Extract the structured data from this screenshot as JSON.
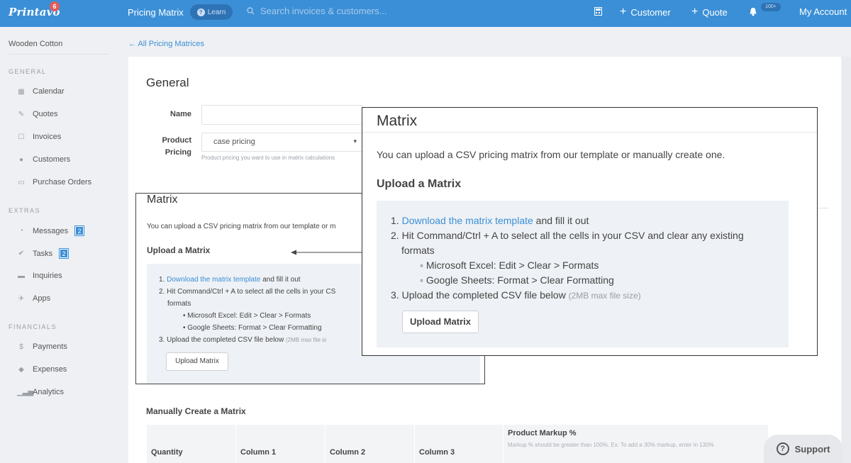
{
  "nav": {
    "brand": "Printavo",
    "brand_badge": "6",
    "title": "Pricing Matrix",
    "learn_label": "Learn",
    "search_placeholder": "Search invoices & customers...",
    "customer_label": "Customer",
    "quote_label": "Quote",
    "notifications_badge": "100+",
    "account_label": "My Account"
  },
  "sidebar": {
    "company": "Wooden Cotton",
    "sections": {
      "general": "GENERAL",
      "extras": "EXTRAS",
      "financials": "FINANCIALS"
    },
    "items": {
      "calendar": "Calendar",
      "quotes": "Quotes",
      "invoices": "Invoices",
      "customers": "Customers",
      "purchase_orders": "Purchase Orders",
      "messages": "Messages",
      "messages_count": "2",
      "tasks": "Tasks",
      "tasks_count": "2",
      "inquiries": "Inquiries",
      "apps": "Apps",
      "payments": "Payments",
      "expenses": "Expenses",
      "analytics": "Analytics"
    }
  },
  "main": {
    "breadcrumb": "← All Pricing Matrices",
    "general_heading": "General",
    "name_label": "Name",
    "name_value": "",
    "product_pricing_label_1": "Product",
    "product_pricing_label_2": "Pricing",
    "product_pricing_value": "case pricing",
    "product_pricing_hint": "Product pricing you want to use in matrix calculations"
  },
  "matrix": {
    "heading": "Matrix",
    "intro": "You can upload a CSV pricing matrix from our template or manually create one.",
    "upload_heading": "Upload a Matrix",
    "step1_num": "1.",
    "step1_link": "Download the matrix template",
    "step1_rest": " and fill it out",
    "step2_num": "2.",
    "step2_text_a": "Hit Command/Ctrl + A to select all the cells in your CSV and clear any existing",
    "step2_text_b": "formats",
    "bullet1": "Microsoft Excel: Edit > Clear > Formats",
    "bullet2": "Google Sheets: Format > Clear Formatting",
    "step3_num": "3.",
    "step3_text": "Upload the completed CSV file below ",
    "step3_note": "(2MB max file size)",
    "upload_button": "Upload Matrix",
    "bg_intro_cut": "You can upload a CSV pricing matrix from our template or m",
    "bg_step2_cut": "Hit Command/Ctrl + A to select all the cells in your CS",
    "bg_step3_note_cut": "(2MB max file si"
  },
  "manual": {
    "heading": "Manually Create a Matrix",
    "columns": [
      "Quantity",
      "Column 1",
      "Column 2",
      "Column 3"
    ],
    "markup_title": "Product Markup %",
    "markup_desc": "Markup % should be greater than 100%. Ex: To add a 30% markup, enter in 130%"
  },
  "support": {
    "label": "Support"
  }
}
